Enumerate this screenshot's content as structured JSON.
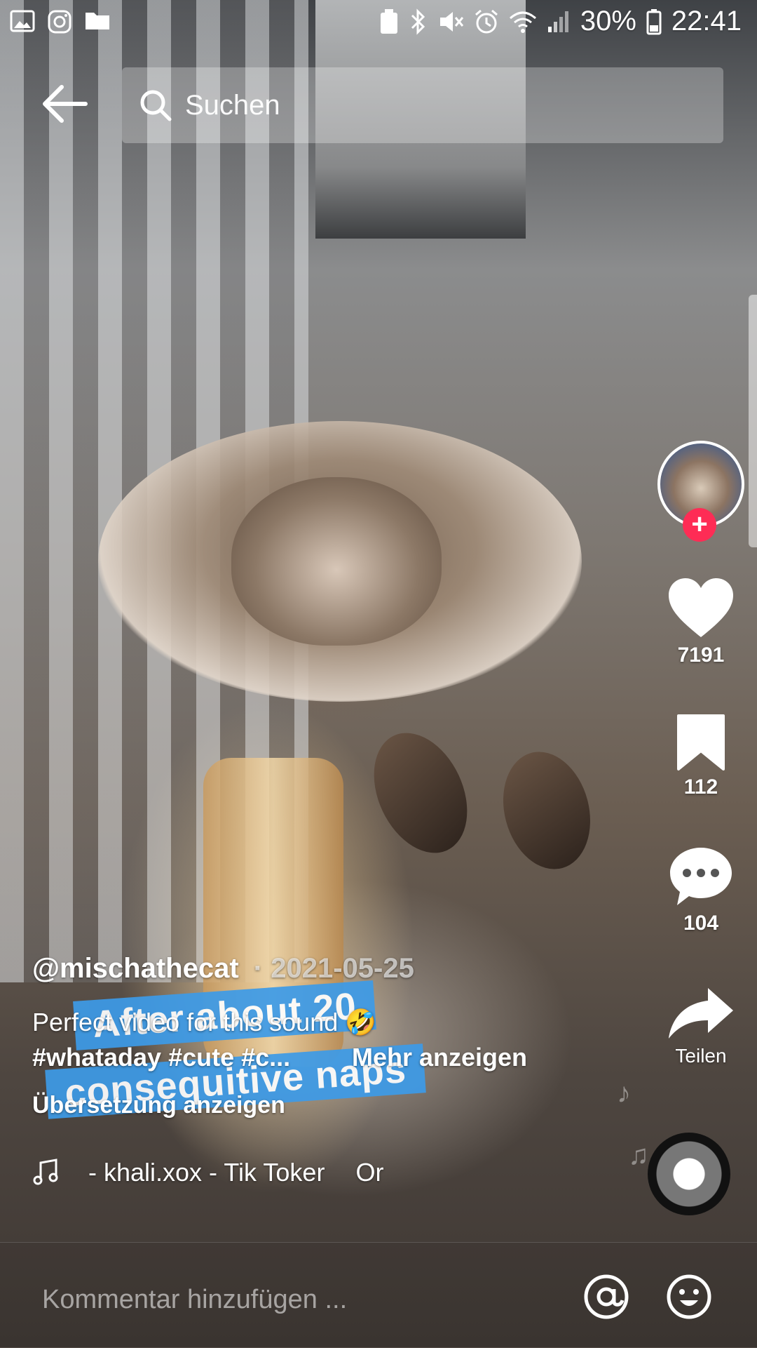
{
  "status_bar": {
    "left_icons": [
      "gallery-icon",
      "instagram-icon",
      "folder-icon"
    ],
    "right_icons": [
      "recycle-icon",
      "bluetooth-icon",
      "mute-icon",
      "alarm-icon",
      "wifi-icon",
      "signal-icon"
    ],
    "battery": "30%",
    "time": "22:41"
  },
  "search": {
    "placeholder": "Suchen"
  },
  "rail": {
    "likes": "7191",
    "saves": "112",
    "comments": "104",
    "share_label": "Teilen"
  },
  "post": {
    "username": "@mischathecat",
    "date": "· 2021-05-25",
    "caption": "Perfect video for this sound 🤣",
    "hashtags": "#whataday #cute #c...",
    "more_label": "Mehr anzeigen",
    "translate_label": "Übersetzung anzeigen",
    "sticker_line1": "After about 20",
    "sticker_line2": "consequitive naps",
    "music": "- khali.xox - Tik Toker",
    "music_trailing": "Or"
  },
  "comment": {
    "placeholder": "Kommentar hinzufügen ..."
  },
  "colors": {
    "follow_accent": "#fe2c55",
    "sticker_blue": "#3d9be8"
  }
}
